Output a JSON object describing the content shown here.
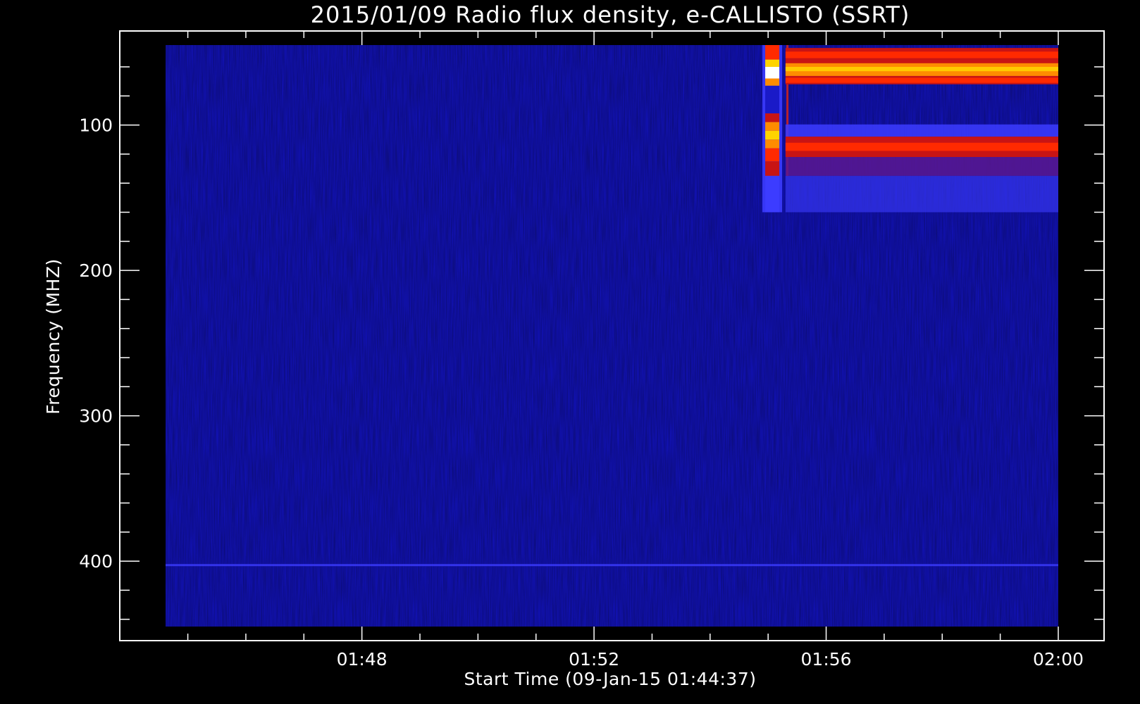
{
  "chart_data": {
    "type": "heatmap",
    "title": "2015/01/09  Radio flux density, e-CALLISTO (SSRT)",
    "xlabel": "Start Time (09-Jan-15 01:44:37)",
    "ylabel": "Frequency (MHZ)",
    "x_range": [
      "01:44:37",
      "02:00:00"
    ],
    "y_range_mhz": [
      45,
      445
    ],
    "y_axis_inverted": true,
    "x_ticks": [
      {
        "label": "01:48",
        "minutes": 108
      },
      {
        "label": "01:52",
        "minutes": 112
      },
      {
        "label": "01:56",
        "minutes": 116
      },
      {
        "label": "02:00",
        "minutes": 120
      }
    ],
    "x_minor_tick_minutes": [
      106,
      107,
      109,
      110,
      111,
      113,
      114,
      115,
      117,
      118,
      119
    ],
    "y_ticks": [
      100,
      200,
      300,
      400
    ],
    "y_minor_tick_mhz": [
      60,
      80,
      120,
      140,
      160,
      180,
      220,
      240,
      260,
      280,
      320,
      340,
      360,
      380,
      420,
      440
    ],
    "colormap": [
      "#00007a",
      "#1a1ac8",
      "#3c3cff",
      "#c81414",
      "#ff2a00",
      "#ff8c00",
      "#ffd400",
      "#ffffff"
    ],
    "background_color": "#1010b4",
    "events": [
      {
        "name": "burst onset",
        "start": "01:54:57",
        "freq_mhz": [
          45,
          160
        ]
      },
      {
        "name": "persistent emission band",
        "start": "01:55:18",
        "end": "02:00:00",
        "freq_mhz": [
          47,
          72
        ],
        "intensity": "very high"
      },
      {
        "name": "persistent emission band",
        "start": "01:55:18",
        "end": "02:00:00",
        "freq_mhz": [
          108,
          122
        ],
        "intensity": "high"
      },
      {
        "name": "weak emission band",
        "start": "01:55:18",
        "end": "02:00:00",
        "freq_mhz": [
          122,
          135
        ],
        "intensity": "medium"
      },
      {
        "name": "narrowband line",
        "start": "01:44:37",
        "end": "02:00:00",
        "freq_mhz": [
          402,
          403
        ],
        "intensity": "low"
      }
    ]
  }
}
